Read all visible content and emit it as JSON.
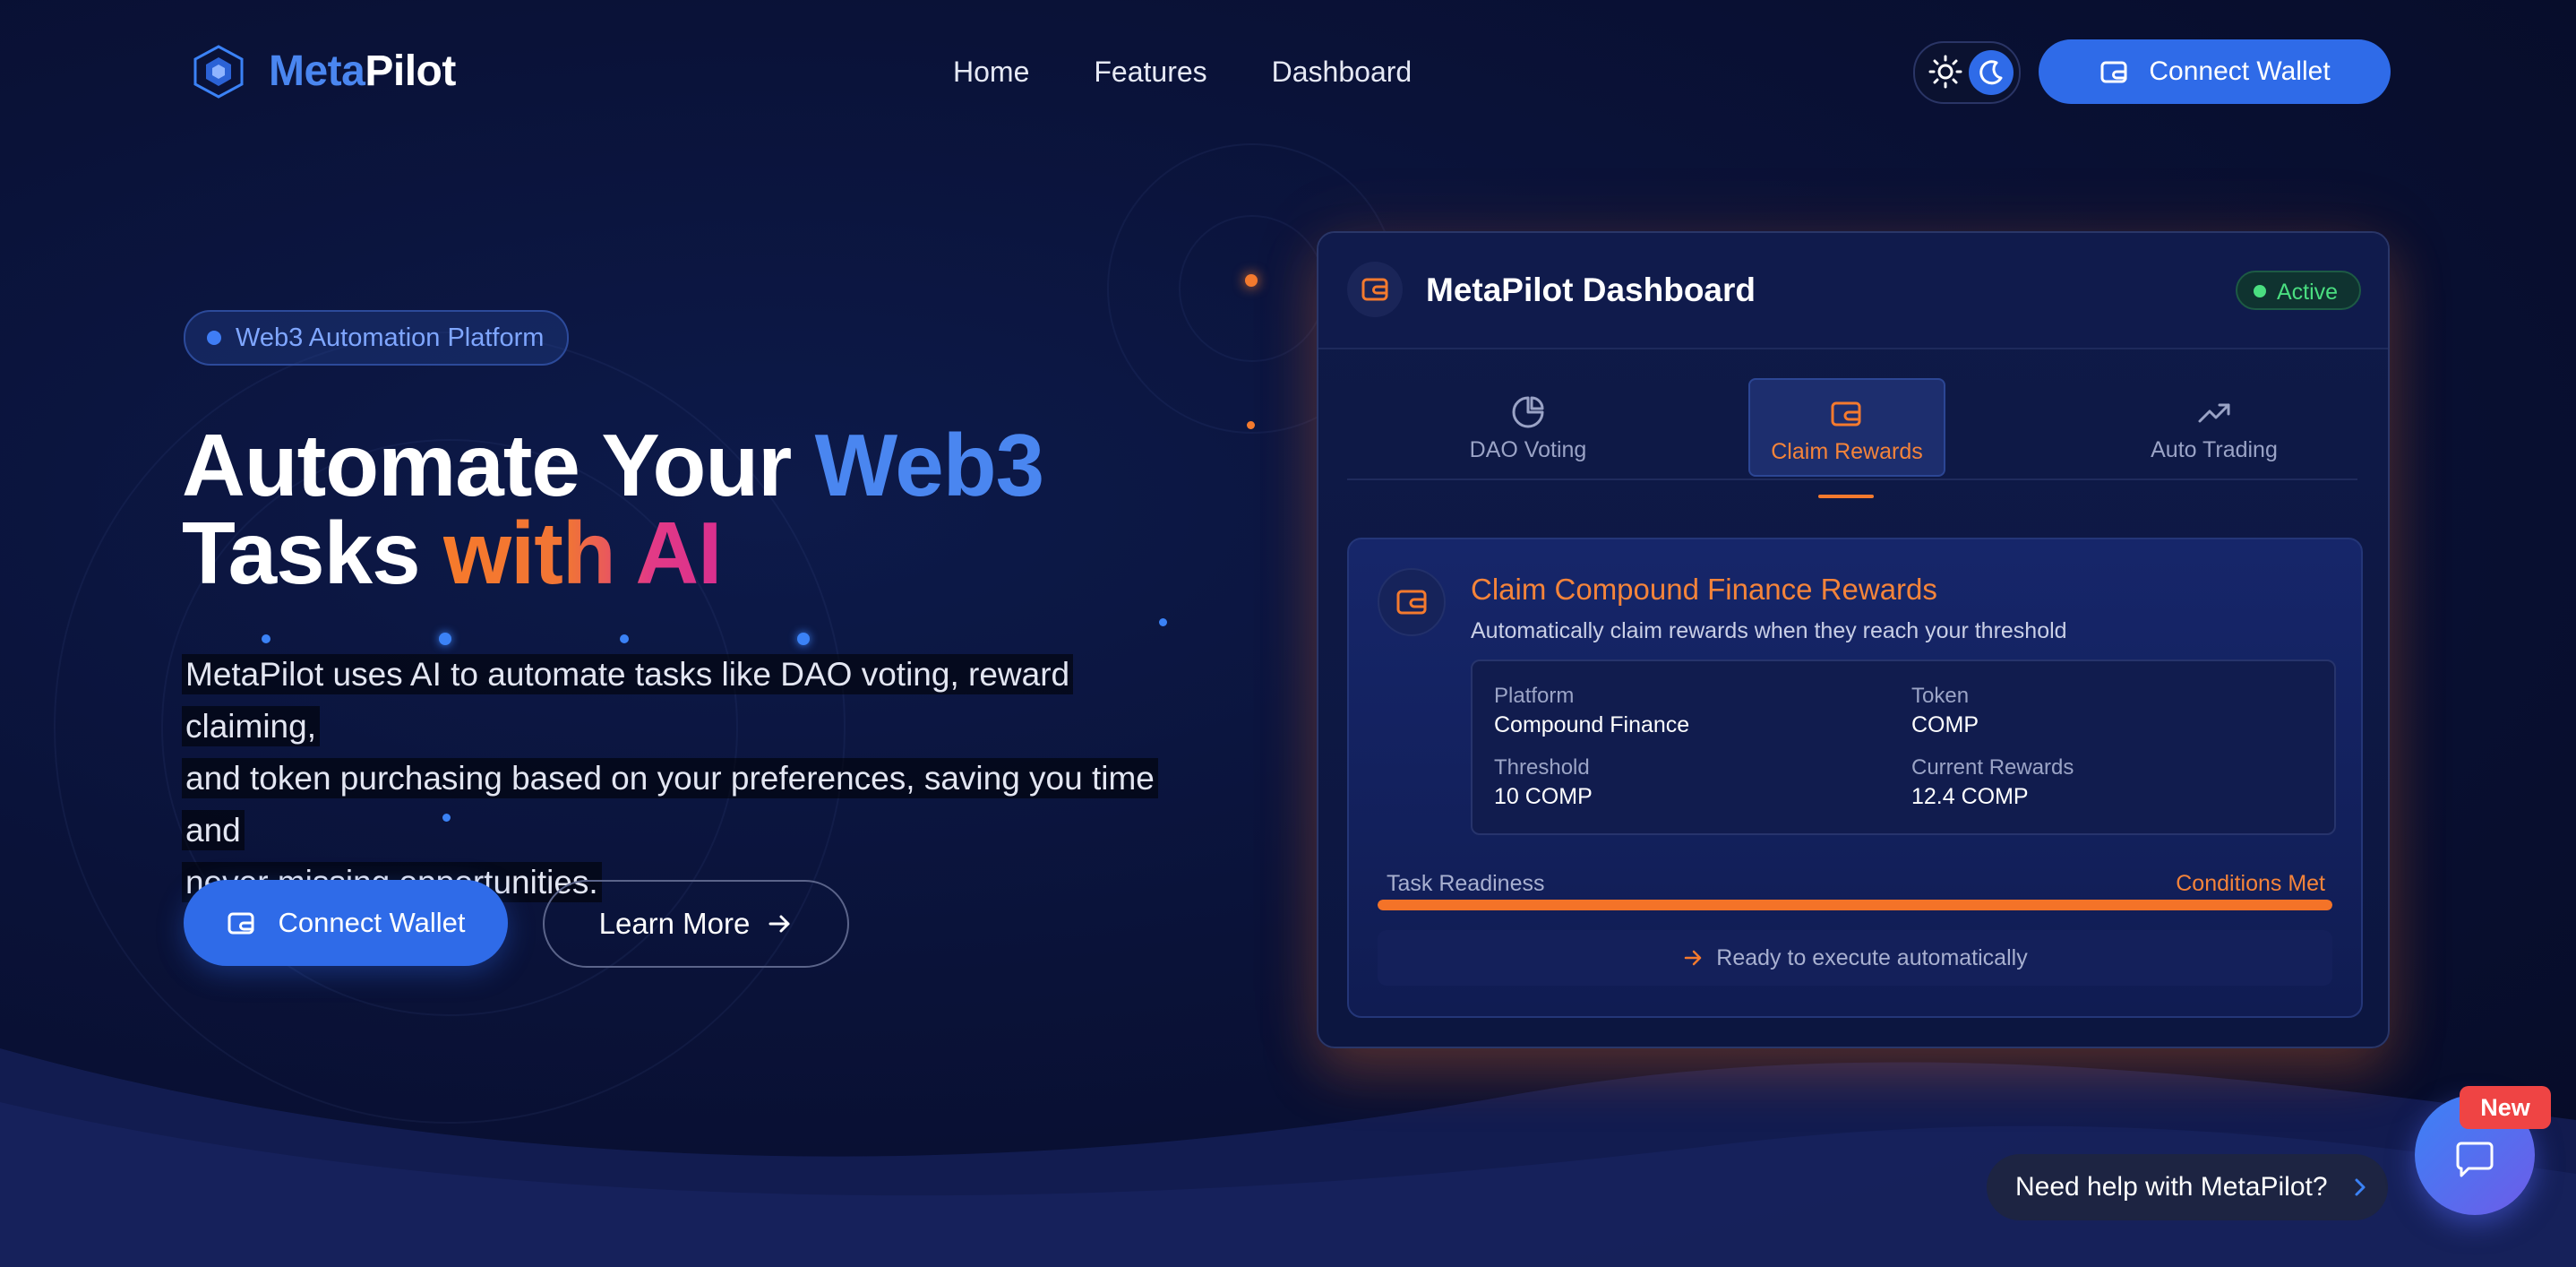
{
  "header": {
    "brand_part1": "Meta",
    "brand_part2": "Pilot",
    "nav": [
      "Home",
      "Features",
      "Dashboard"
    ],
    "connect_wallet_label": "Connect Wallet",
    "theme_icons": [
      "sun-icon",
      "moon-icon"
    ]
  },
  "hero": {
    "badge": "Web3 Automation Platform",
    "headline_line1_a": "Automate Your ",
    "headline_line1_b": "Web3",
    "headline_line2_a": "Tasks ",
    "headline_line2_b": "with AI",
    "description_line1": "MetaPilot uses AI to automate tasks like DAO voting, reward claiming,",
    "description_line2": "and token purchasing based on your preferences, saving you time and",
    "description_line3": "never missing opportunities.",
    "primary_button": "Connect Wallet",
    "secondary_button": "Learn More"
  },
  "dashboard": {
    "title": "MetaPilot Dashboard",
    "status": "Active",
    "tabs": [
      {
        "label": "DAO Voting",
        "icon": "pie-chart-icon"
      },
      {
        "label": "Claim Rewards",
        "icon": "wallet-icon",
        "active": true
      },
      {
        "label": "Auto Trading",
        "icon": "trending-up-icon"
      }
    ],
    "task": {
      "title": "Claim Compound Finance Rewards",
      "subtitle": "Automatically claim rewards when they reach your threshold",
      "platform_label": "Platform",
      "platform_value": "Compound Finance",
      "token_label": "Token",
      "token_value": "COMP",
      "threshold_label": "Threshold",
      "threshold_value": "10 COMP",
      "rewards_label": "Current Rewards",
      "rewards_value": "12.4 COMP",
      "readiness_label": "Task Readiness",
      "readiness_status": "Conditions Met",
      "readiness_progress": 1.0,
      "execute_note": "Ready to execute automatically"
    }
  },
  "help": {
    "prompt": "Need help with MetaPilot?",
    "badge": "New"
  },
  "colors": {
    "accent_blue": "#2f6be8",
    "accent_orange": "#f47a2e",
    "status_green": "#4ade80",
    "new_badge_red": "#ef4444"
  }
}
